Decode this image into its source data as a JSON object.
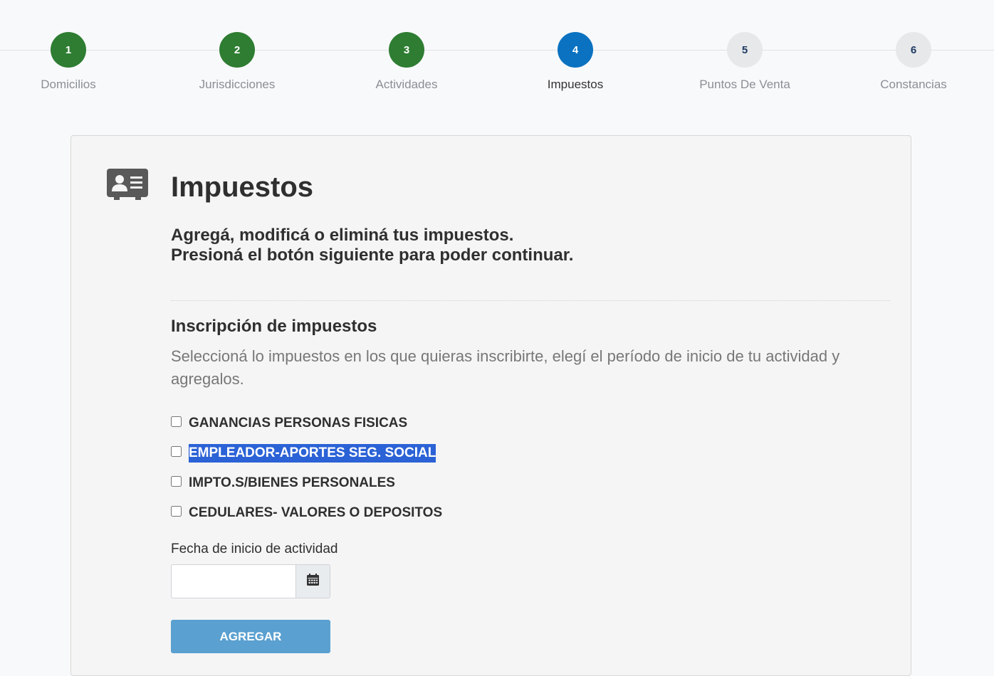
{
  "stepper": {
    "steps": [
      {
        "number": "1",
        "label": "Domicilios",
        "state": "done"
      },
      {
        "number": "2",
        "label": "Jurisdicciones",
        "state": "done"
      },
      {
        "number": "3",
        "label": "Actividades",
        "state": "done"
      },
      {
        "number": "4",
        "label": "Impuestos",
        "state": "active"
      },
      {
        "number": "5",
        "label": "Puntos De Venta",
        "state": "todo"
      },
      {
        "number": "6",
        "label": "Constancias",
        "state": "todo"
      }
    ]
  },
  "card": {
    "icon": "id-card-icon",
    "title": "Impuestos",
    "subtitle_line1": "Agregá, modificá o eliminá tus impuestos.",
    "subtitle_line2": "Presioná el botón siguiente para poder continuar."
  },
  "section": {
    "title": "Inscripción de impuestos",
    "description": "Seleccioná lo impuestos en los que quieras inscribirte, elegí el período de inicio de tu actividad y agregalos."
  },
  "options": [
    {
      "label": "GANANCIAS PERSONAS FISICAS",
      "checked": false,
      "highlighted": false
    },
    {
      "label": "EMPLEADOR-APORTES SEG. SOCIAL",
      "checked": false,
      "highlighted": true
    },
    {
      "label": "IMPTO.S/BIENES PERSONALES",
      "checked": false,
      "highlighted": false
    },
    {
      "label": "CEDULARES- VALORES O DEPOSITOS",
      "checked": false,
      "highlighted": false
    }
  ],
  "date_field": {
    "label": "Fecha de inicio de actividad",
    "value": "",
    "placeholder": "",
    "button_icon": "calendar-icon"
  },
  "add_button": {
    "label": "AGREGAR"
  },
  "colors": {
    "done": "#2e7d32",
    "active": "#0a72c0",
    "todo": "#e7e8ea",
    "highlight": "#2b62d6",
    "button": "#5aa0d0"
  }
}
